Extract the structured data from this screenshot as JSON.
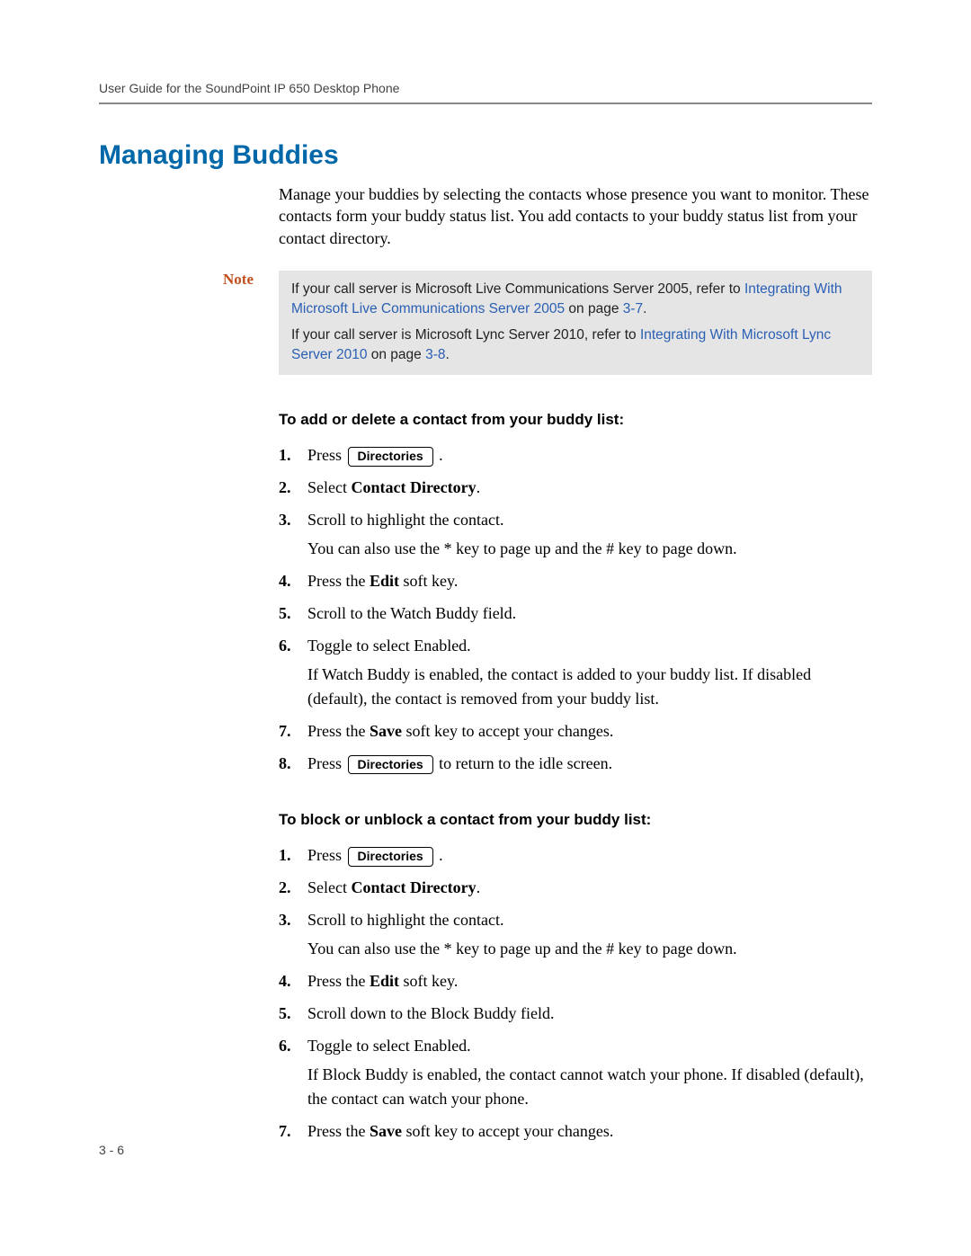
{
  "header": {
    "running": "User Guide for the SoundPoint IP 650 Desktop Phone"
  },
  "title": "Managing Buddies",
  "intro": "Manage your buddies by selecting the contacts whose presence you want to monitor. These contacts form your buddy status list. You add contacts to your buddy status list from your contact directory.",
  "note": {
    "label": "Note",
    "line1_pre": "If your call server is Microsoft Live Communications Server 2005, refer to ",
    "line1_link": "Integrating With Microsoft Live Communications Server 2005",
    "line1_mid": " on page ",
    "line1_page": "3-7",
    "line1_post": ".",
    "line2_pre": "If your call server is Microsoft Lync Server 2010, refer to ",
    "line2_link": "Integrating With Microsoft Lync Server 2010",
    "line2_mid": " on page ",
    "line2_page": "3-8",
    "line2_post": "."
  },
  "buttons": {
    "directories": "Directories"
  },
  "proc1": {
    "title": "To add or delete a contact from your buddy list:",
    "s1_pre": "Press ",
    "s1_post": " .",
    "s2_pre": "Select ",
    "s2_bold": "Contact Directory",
    "s2_post": ".",
    "s3": "Scroll to highlight the contact.",
    "s3_sub": "You can also use the * key to page up and the # key to page down.",
    "s4_pre": "Press the ",
    "s4_bold": "Edit",
    "s4_post": " soft key.",
    "s5": "Scroll to the Watch Buddy field.",
    "s6": "Toggle to select Enabled.",
    "s6_sub": "If Watch Buddy is enabled, the contact is added to your buddy list. If disabled (default), the contact is removed from your buddy list.",
    "s7_pre": "Press the ",
    "s7_bold": "Save",
    "s7_post": " soft key to accept your changes.",
    "s8_pre": "Press ",
    "s8_post": " to return to the idle screen."
  },
  "proc2": {
    "title": "To block or unblock a contact from your buddy list:",
    "s1_pre": "Press ",
    "s1_post": " .",
    "s2_pre": "Select ",
    "s2_bold": "Contact Directory",
    "s2_post": ".",
    "s3": "Scroll to highlight the contact.",
    "s3_sub": "You can also use the * key to page up and the # key to page down.",
    "s4_pre": "Press the ",
    "s4_bold": "Edit",
    "s4_post": " soft key.",
    "s5": "Scroll down to the Block Buddy field.",
    "s6": "Toggle to select Enabled.",
    "s6_sub": "If Block Buddy is enabled, the contact cannot watch your phone. If disabled (default), the contact can watch your phone.",
    "s7_pre": "Press the ",
    "s7_bold": "Save",
    "s7_post": " soft key to accept your changes."
  },
  "page_number": "3 - 6"
}
